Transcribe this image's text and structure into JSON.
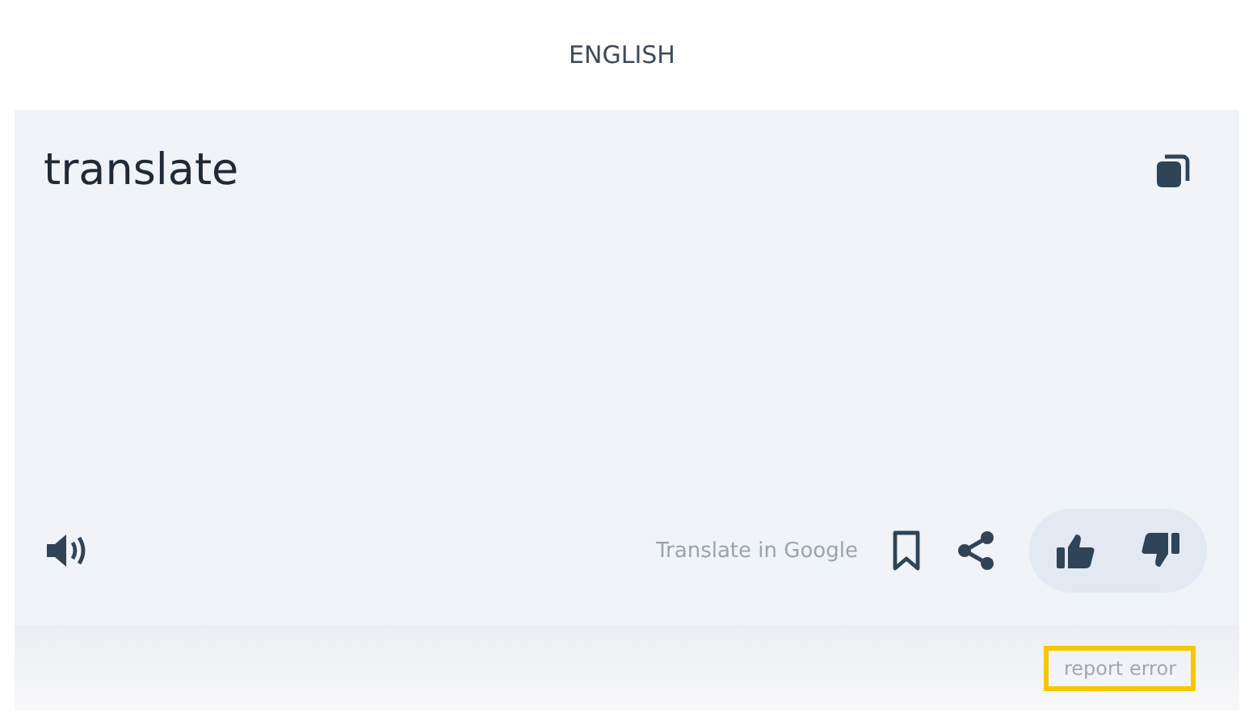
{
  "language": "ENGLISH",
  "translation": "translate",
  "google_link": "Translate in Google",
  "report_error": {
    "label": "report error",
    "highlighted": true
  }
}
